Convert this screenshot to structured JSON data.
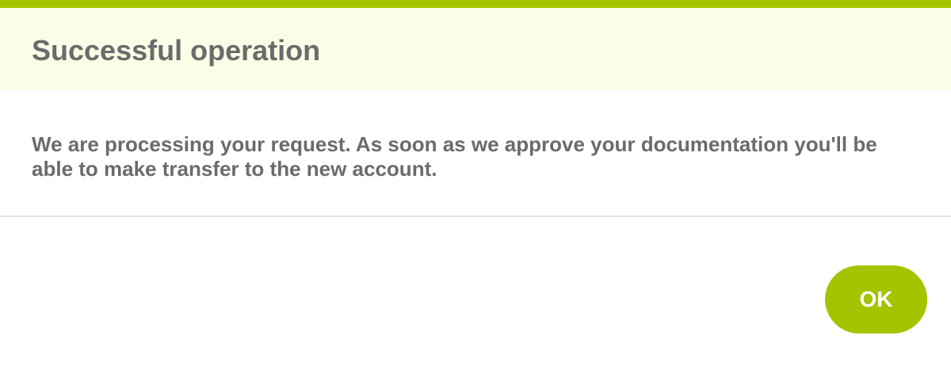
{
  "dialog": {
    "title": "Successful operation",
    "message": "We are processing your request. As soon as we approve your documentation you'll be able to make transfer to the new account.",
    "ok_label": "OK"
  },
  "colors": {
    "accent": "#a6c300",
    "header_background": "#f9ffe6",
    "text": "#6b6b6b",
    "divider": "#e3e3e3"
  }
}
